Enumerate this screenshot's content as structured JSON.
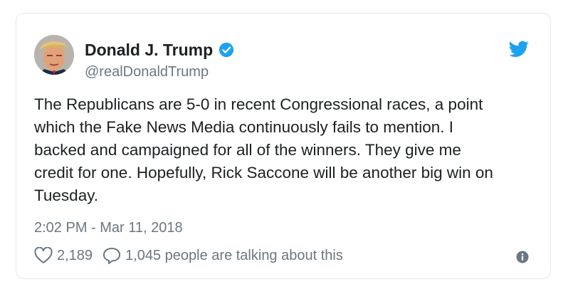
{
  "tweet": {
    "author_name": "Donald J. Trump",
    "handle": "@realDonaldTrump",
    "text": "The Republicans are 5-0 in recent Congressional races, a point\nwhich the Fake News Media continuously fails to mention. I\nbacked and campaigned for all of the winners. They give me\ncredit for one. Hopefully, Rick Saccone will be another big win on\nTuesday.",
    "timestamp": "2:02 PM - Mar 11, 2018",
    "likes": "2,189",
    "replies_label": "1,045 people are talking about this"
  },
  "icons": {
    "verified": "verified-badge-icon",
    "platform": "twitter-bird-icon",
    "like": "heart-icon",
    "reply": "speech-bubble-icon",
    "info": "info-icon"
  },
  "colors": {
    "brand_blue": "#1da1f2",
    "text_primary": "#1c2022",
    "text_secondary": "#697882",
    "border": "#e1e8ed"
  }
}
